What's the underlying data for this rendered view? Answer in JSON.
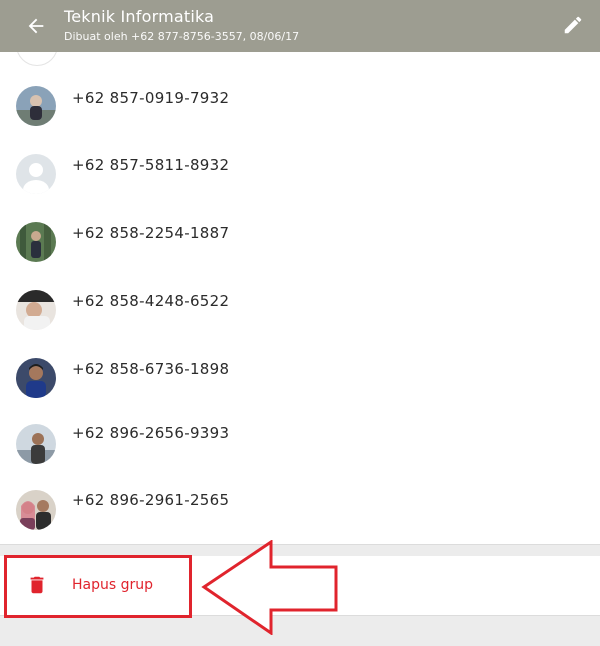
{
  "header": {
    "title": "Teknik Informatika",
    "subtitle": "Dibuat oleh +62 877-8756-3557, 08/06/17",
    "back_icon": "arrow-back-icon",
    "edit_icon": "pencil-icon",
    "background_color": "#9d9d91"
  },
  "members": [
    {
      "phone": "+62 857-0919-7932",
      "avatar": "photo"
    },
    {
      "phone": "+62 857-5811-8932",
      "avatar": "default-person"
    },
    {
      "phone": "+62 858-2254-1887",
      "avatar": "photo"
    },
    {
      "phone": "+62 858-4248-6522",
      "avatar": "photo"
    },
    {
      "phone": "+62 858-6736-1898",
      "avatar": "photo"
    },
    {
      "phone": "+62 896-2656-9393",
      "avatar": "photo"
    },
    {
      "phone": "+62 896-2961-2565",
      "avatar": "photo"
    }
  ],
  "actions": {
    "delete_group_label": "Hapus grup",
    "delete_icon": "trash-icon",
    "delete_color": "#e0242d"
  },
  "annotation": {
    "color": "#e0242d"
  }
}
